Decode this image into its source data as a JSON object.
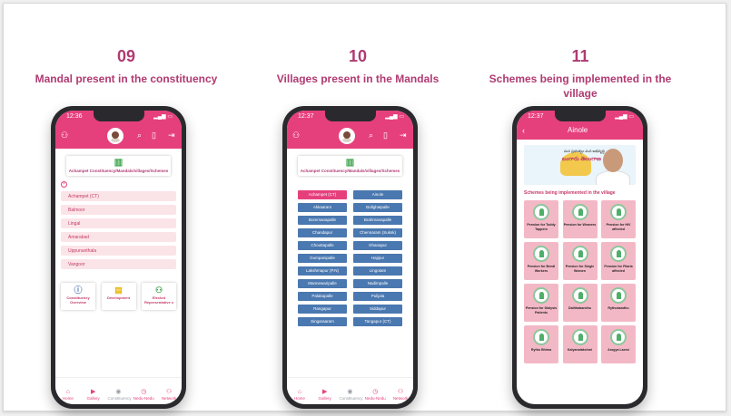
{
  "steps": [
    {
      "number": "09",
      "text": "Mandal present in the constituency"
    },
    {
      "number": "10",
      "text": "Villages present in the Mandals"
    },
    {
      "number": "11",
      "text": "Schemes being implemented in the village"
    }
  ],
  "phone1": {
    "time": "12:36",
    "header": "Achampet Constituency/Mandals/villages/Schemes",
    "mandals": [
      "Achampet (CT)",
      "Balmoor",
      "Lingal",
      "Amarabad",
      "Uppununthala",
      "Vangoor"
    ],
    "tiles": [
      {
        "icon": "info-icon",
        "label": "Constituency Overview"
      },
      {
        "icon": "document-icon",
        "label": "Development"
      },
      {
        "icon": "people-icon",
        "label": "Elected Representative s"
      }
    ],
    "nav": [
      "Home",
      "Gallery",
      "Constituency",
      "Nedu-Nedu",
      "Network"
    ]
  },
  "phone2": {
    "time": "12:37",
    "header": "Achampet Constituency/Mandals/villages/Schemes",
    "villages": [
      "Achampet (CT)",
      "Ainole",
      "Akkaaram",
      "Bollghatpalle",
      "Bommanapalle",
      "Brahmanapalle",
      "Chandapur",
      "Chennaram (Suksk)",
      "Chouttapalle",
      "Ghanapur",
      "Gumpanipalle",
      "Hajipur",
      "Lakshmapur (P.N)",
      "Lingotam",
      "Mannewaripalle",
      "Nadimpalle",
      "Palakapalle",
      "Pulijala",
      "Rangapur",
      "Siddapur",
      "Singaraaram",
      "Tangapur (CT)"
    ],
    "nav": [
      "Home",
      "Gallery",
      "Constituency",
      "Nedu-Nedu",
      "Network"
    ]
  },
  "phone3": {
    "time": "12:37",
    "title": "Ainole",
    "banner_line1": "మన ప్రభుత్వం మన అభివృద్ధి",
    "banner_line2": "బంగారు తెలంగాణ",
    "section_title": "Schemes being implemented in the village",
    "schemes": [
      "Pension for Toddy Tappers",
      "Pension for Weavers",
      "Pension for HIV affected",
      "Pension for Beedi Workers",
      "Pension for Single Women",
      "Pension for Filaria affected",
      "Pension for Dialysis Patients",
      "Dalithabandhu",
      "Rythubandhu",
      "Rythu Bhima",
      "Kalyanalakshmi",
      "Arogya Laxmi"
    ]
  }
}
